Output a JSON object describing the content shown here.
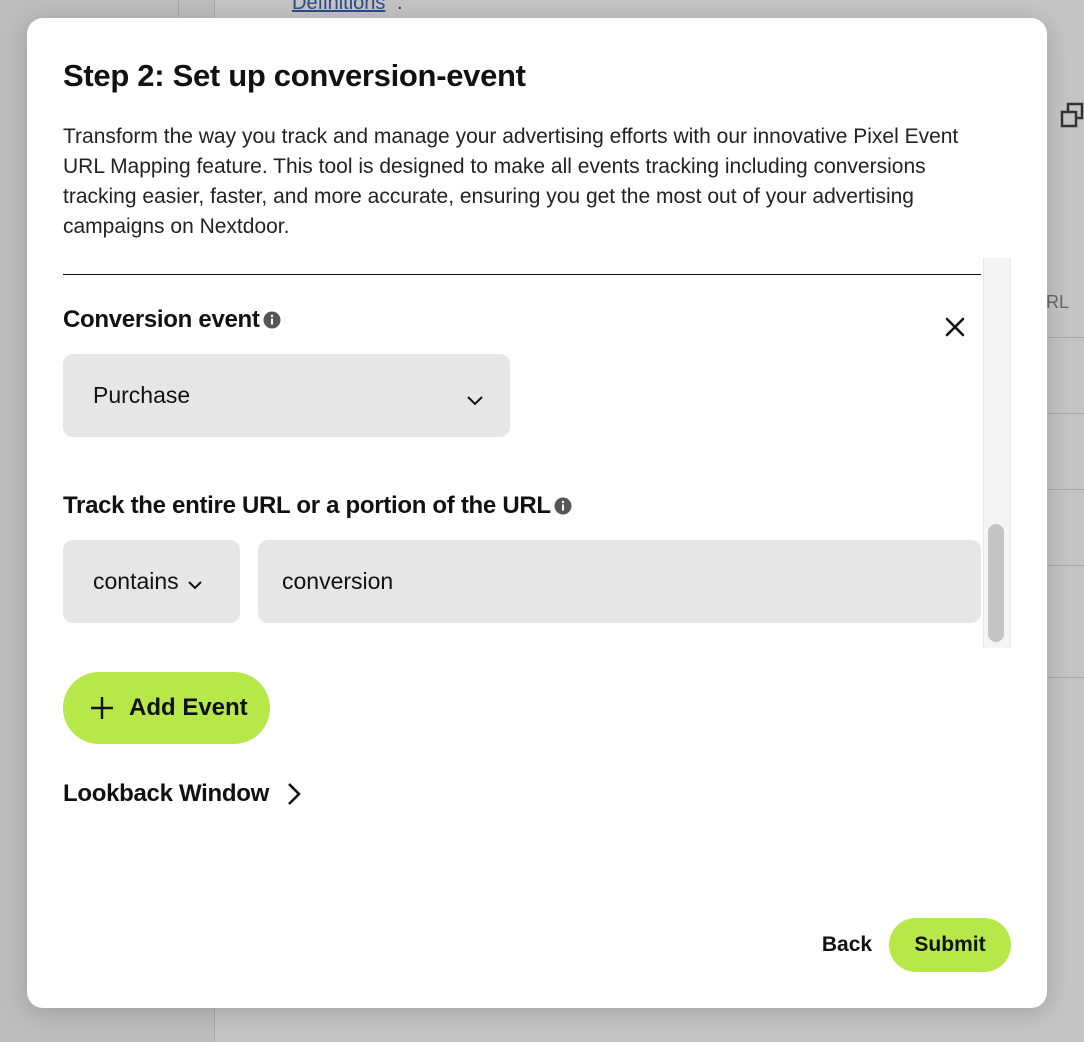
{
  "background": {
    "link_text": "Definitions",
    "link_trailing": ".",
    "column_fragment": "RL"
  },
  "modal": {
    "title": "Step 2: Set up conversion-event",
    "description": "Transform the way you track and manage your advertising efforts with our innovative Pixel Event URL Mapping feature. This tool is designed to make all events tracking including conversions tracking easier, faster, and more accurate, ensuring you get the most out of your advertising campaigns on Nextdoor.",
    "conversion_event": {
      "label": "Conversion event",
      "selected": "Purchase"
    },
    "url_tracking": {
      "label": "Track the entire URL or a portion of the URL",
      "match_type": "contains",
      "value": "conversion"
    },
    "add_event_label": "Add Event",
    "lookback_label": "Lookback Window",
    "back_label": "Back",
    "submit_label": "Submit"
  },
  "colors": {
    "accent": "#b6e84a",
    "field_bg": "#e6e6e6",
    "text": "#111111"
  },
  "icons": [
    "info-icon",
    "close-icon",
    "chevron-down-icon",
    "plus-icon",
    "chevron-right-icon",
    "copy-icon"
  ]
}
